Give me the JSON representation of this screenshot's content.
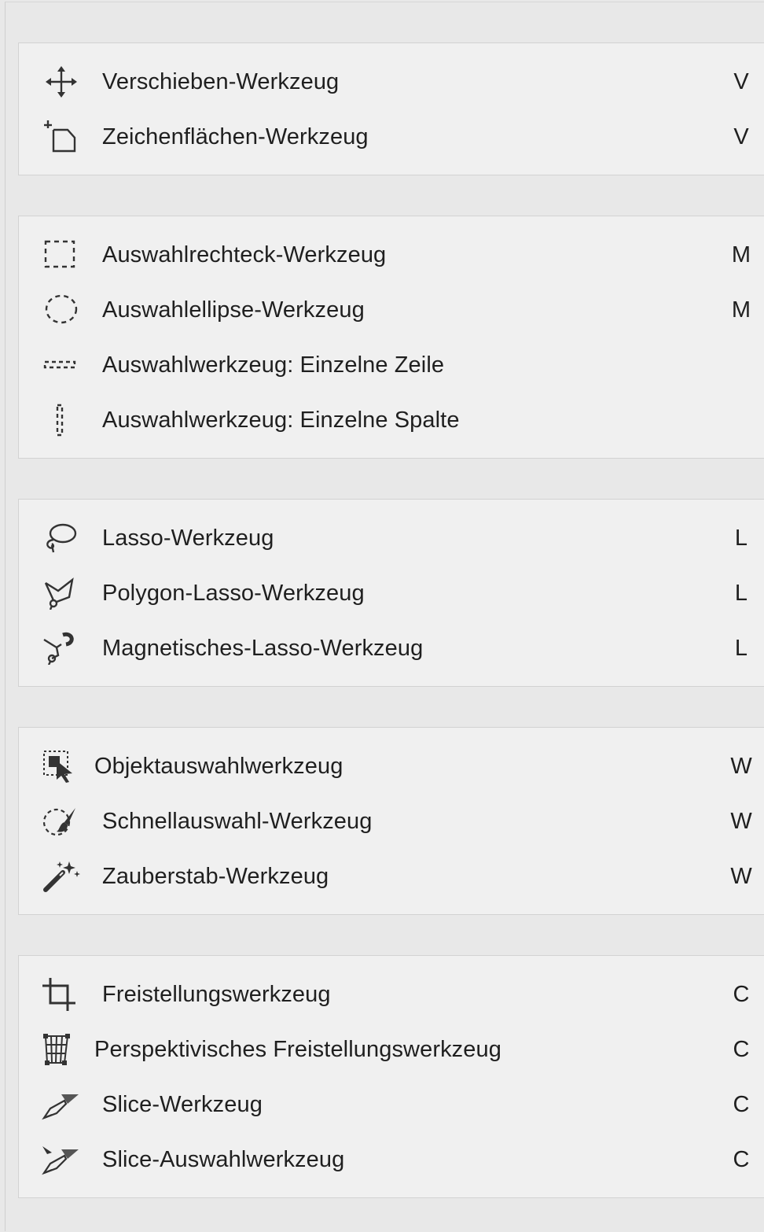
{
  "groups": [
    {
      "items": [
        {
          "icon": "move-icon",
          "label": "Verschieben-Werkzeug",
          "shortcut": "V"
        },
        {
          "icon": "artboard-icon",
          "label": "Zeichenflächen-Werkzeug",
          "shortcut": "V"
        }
      ]
    },
    {
      "items": [
        {
          "icon": "rectangular-marquee-icon",
          "label": "Auswahlrechteck-Werkzeug",
          "shortcut": "M"
        },
        {
          "icon": "elliptical-marquee-icon",
          "label": "Auswahlellipse-Werkzeug",
          "shortcut": "M"
        },
        {
          "icon": "single-row-marquee-icon",
          "label": "Auswahlwerkzeug: Einzelne Zeile",
          "shortcut": ""
        },
        {
          "icon": "single-column-marquee-icon",
          "label": "Auswahlwerkzeug: Einzelne Spalte",
          "shortcut": ""
        }
      ]
    },
    {
      "items": [
        {
          "icon": "lasso-icon",
          "label": "Lasso-Werkzeug",
          "shortcut": "L"
        },
        {
          "icon": "polygonal-lasso-icon",
          "label": "Polygon-Lasso-Werkzeug",
          "shortcut": "L"
        },
        {
          "icon": "magnetic-lasso-icon",
          "label": "Magnetisches-Lasso-Werkzeug",
          "shortcut": "L"
        }
      ]
    },
    {
      "items": [
        {
          "icon": "object-selection-icon",
          "label": "Objektauswahlwerkzeug",
          "shortcut": "W"
        },
        {
          "icon": "quick-selection-icon",
          "label": "Schnellauswahl-Werkzeug",
          "shortcut": "W"
        },
        {
          "icon": "magic-wand-icon",
          "label": "Zauberstab-Werkzeug",
          "shortcut": "W"
        }
      ]
    },
    {
      "items": [
        {
          "icon": "crop-icon",
          "label": "Freistellungswerkzeug",
          "shortcut": "C"
        },
        {
          "icon": "perspective-crop-icon",
          "label": "Perspektivisches Freistellungswerkzeug",
          "shortcut": "C"
        },
        {
          "icon": "slice-icon",
          "label": "Slice-Werkzeug",
          "shortcut": "C"
        },
        {
          "icon": "slice-select-icon",
          "label": "Slice-Auswahlwerkzeug",
          "shortcut": "C"
        }
      ]
    }
  ]
}
